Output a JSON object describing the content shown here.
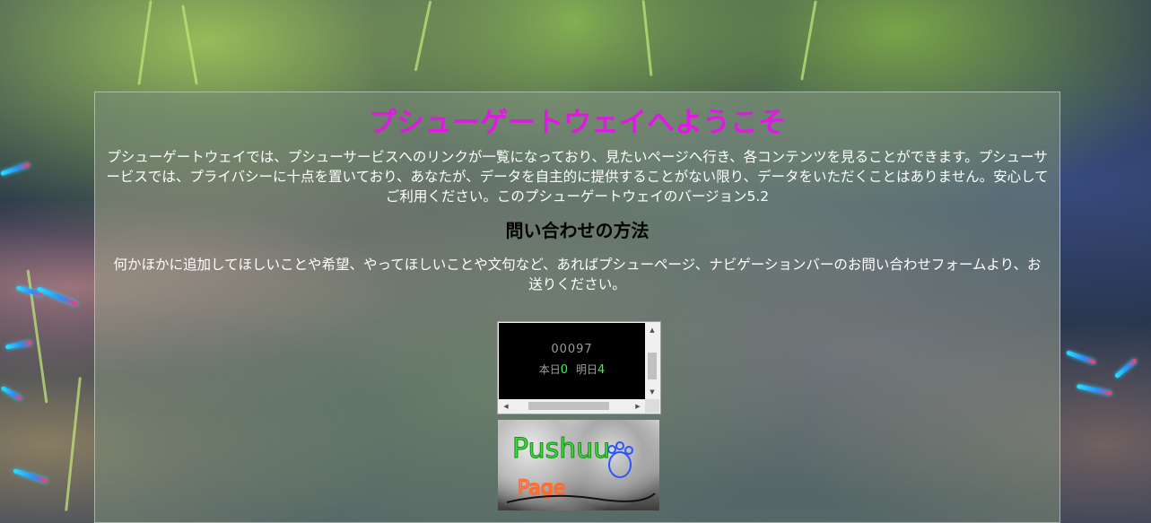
{
  "page": {
    "title": "プシューゲートウェイへようこそ",
    "intro": "プシューゲートウェイでは、プシューサービスへのリンクが一覧になっており、見たいページへ行き、各コンテンツを見ることができます。プシューサービスでは、プライバシーに十点を置いており、あなたが、データを自主的に提供することがない限り、データをいただくことはありません。安心してご利用ください。このプシューゲートウェイのバージョン5.2",
    "contact_heading": "問い合わせの方法",
    "contact_text": "何かほかに追加してほしいことや希望、やってほしいことや文句など、あればプシューページ、ナビゲーションバーのお問い合わせフォームより、お送りください。"
  },
  "counter": {
    "total": "00097",
    "today_label": "本日",
    "today_value": "0",
    "tomorrow_label": "明日",
    "tomorrow_value": "4"
  },
  "banner": {
    "text_line1": "Pushuu",
    "text_line2": "Page"
  },
  "colors": {
    "title": "#e316e6",
    "counter_digits": "#33ff33"
  },
  "icons": {
    "scroll_up": "scroll-up-arrow-icon",
    "scroll_down": "scroll-down-arrow-icon",
    "scroll_left": "scroll-left-arrow-icon",
    "scroll_right": "scroll-right-arrow-icon",
    "paw": "paw-icon"
  }
}
